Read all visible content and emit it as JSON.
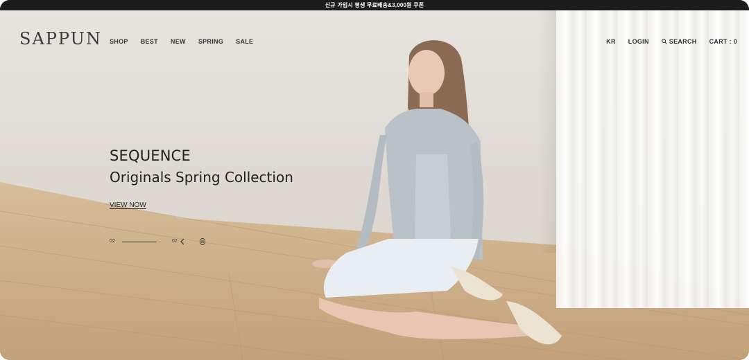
{
  "promo": {
    "text": "신규 가입시 평생 무료배송&3,000원 쿠폰"
  },
  "brand": {
    "name": "SAPPUN"
  },
  "nav": {
    "left": [
      "SHOP",
      "BEST",
      "NEW",
      "SPRING",
      "SALE"
    ],
    "right": {
      "lang": "KR",
      "login": "LOGIN",
      "search": "SEARCH",
      "cart": "CART : 0"
    }
  },
  "hero": {
    "title": "SEQUENCE",
    "subtitle": "Originals Spring Collection",
    "cta": "VIEW NOW"
  },
  "slider": {
    "current": "02",
    "total": "02",
    "progress": 0.9
  },
  "icons": {
    "search": "search-icon",
    "prev": "chevron-left-icon",
    "play": "pause-icon"
  },
  "colors": {
    "promo_bg": "#1c1c1c",
    "text": "#1f1f1f",
    "wall": "#e3e0db",
    "floor": "#c9a882"
  }
}
